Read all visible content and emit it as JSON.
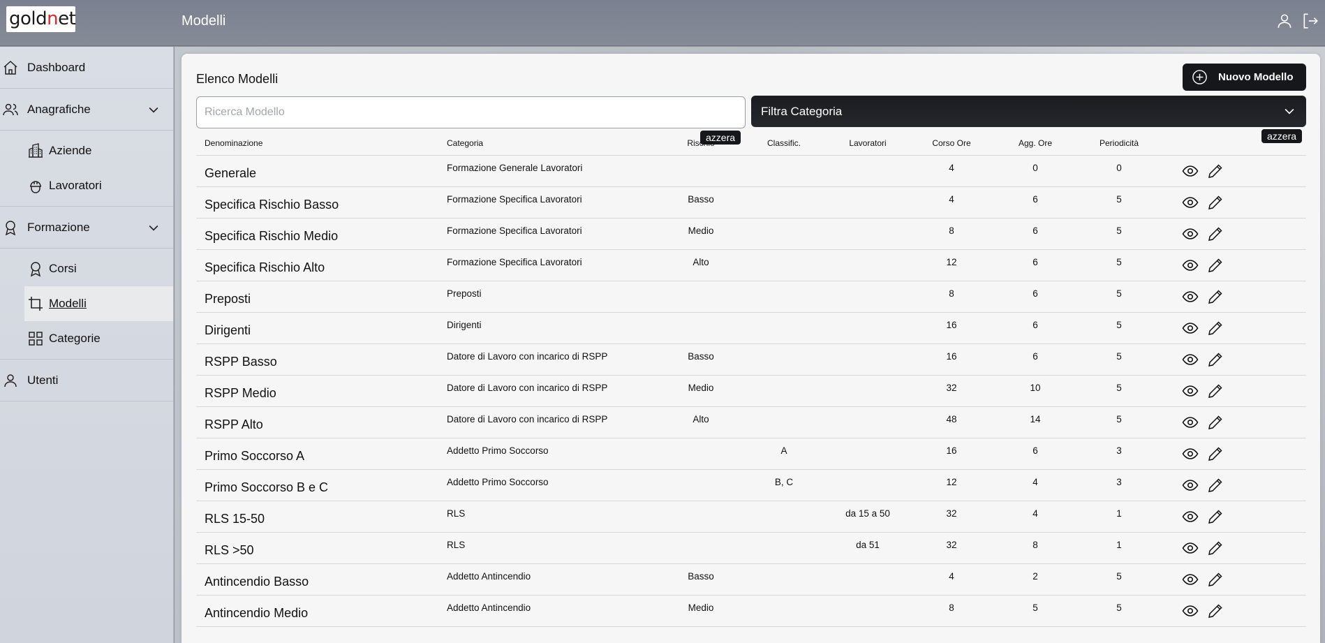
{
  "brand": {
    "logo_prefix": "gold",
    "logo_accent": "n",
    "logo_suffix": "et"
  },
  "header": {
    "title": "Modelli"
  },
  "sidebar": {
    "dashboard": "Dashboard",
    "anagrafiche": "Anagrafiche",
    "aziende": "Aziende",
    "lavoratori": "Lavoratori",
    "formazione": "Formazione",
    "corsi": "Corsi",
    "modelli": "Modelli",
    "categorie": "Categorie",
    "utenti": "Utenti"
  },
  "main": {
    "title": "Elenco Modelli",
    "new_button": "Nuovo Modello",
    "search_placeholder": "Ricerca Modello",
    "filter_label": "Filtra Categoria",
    "reset_label": "azzera"
  },
  "table": {
    "headers": {
      "name": "Denominazione",
      "category": "Categoria",
      "risk": "Rischio",
      "classification": "Classific.",
      "workers": "Lavoratori",
      "course_hours": "Corso Ore",
      "update_hours": "Agg. Ore",
      "periodicity": "Periodicità"
    },
    "rows": [
      {
        "name": "Generale",
        "category": "Formazione Generale Lavoratori",
        "risk": "",
        "classification": "",
        "workers": "",
        "course_hours": "4",
        "update_hours": "0",
        "periodicity": "0"
      },
      {
        "name": "Specifica Rischio Basso",
        "category": "Formazione Specifica Lavoratori",
        "risk": "Basso",
        "classification": "",
        "workers": "",
        "course_hours": "4",
        "update_hours": "6",
        "periodicity": "5"
      },
      {
        "name": "Specifica Rischio Medio",
        "category": "Formazione Specifica Lavoratori",
        "risk": "Medio",
        "classification": "",
        "workers": "",
        "course_hours": "8",
        "update_hours": "6",
        "periodicity": "5"
      },
      {
        "name": "Specifica Rischio Alto",
        "category": "Formazione Specifica Lavoratori",
        "risk": "Alto",
        "classification": "",
        "workers": "",
        "course_hours": "12",
        "update_hours": "6",
        "periodicity": "5"
      },
      {
        "name": "Preposti",
        "category": "Preposti",
        "risk": "",
        "classification": "",
        "workers": "",
        "course_hours": "8",
        "update_hours": "6",
        "periodicity": "5"
      },
      {
        "name": "Dirigenti",
        "category": "Dirigenti",
        "risk": "",
        "classification": "",
        "workers": "",
        "course_hours": "16",
        "update_hours": "6",
        "periodicity": "5"
      },
      {
        "name": "RSPP Basso",
        "category": "Datore di Lavoro con incarico di RSPP",
        "risk": "Basso",
        "classification": "",
        "workers": "",
        "course_hours": "16",
        "update_hours": "6",
        "periodicity": "5"
      },
      {
        "name": "RSPP Medio",
        "category": "Datore di Lavoro con incarico di RSPP",
        "risk": "Medio",
        "classification": "",
        "workers": "",
        "course_hours": "32",
        "update_hours": "10",
        "periodicity": "5"
      },
      {
        "name": "RSPP Alto",
        "category": "Datore di Lavoro con incarico di RSPP",
        "risk": "Alto",
        "classification": "",
        "workers": "",
        "course_hours": "48",
        "update_hours": "14",
        "periodicity": "5"
      },
      {
        "name": "Primo Soccorso A",
        "category": "Addetto Primo Soccorso",
        "risk": "",
        "classification": "A",
        "workers": "",
        "course_hours": "16",
        "update_hours": "6",
        "periodicity": "3"
      },
      {
        "name": "Primo Soccorso B e C",
        "category": "Addetto Primo Soccorso",
        "risk": "",
        "classification": "B, C",
        "workers": "",
        "course_hours": "12",
        "update_hours": "4",
        "periodicity": "3"
      },
      {
        "name": "RLS 15-50",
        "category": "RLS",
        "risk": "",
        "classification": "",
        "workers": "da 15 a 50",
        "course_hours": "32",
        "update_hours": "4",
        "periodicity": "1"
      },
      {
        "name": "RLS >50",
        "category": "RLS",
        "risk": "",
        "classification": "",
        "workers": "da 51",
        "course_hours": "32",
        "update_hours": "8",
        "periodicity": "1"
      },
      {
        "name": "Antincendio Basso",
        "category": "Addetto Antincendio",
        "risk": "Basso",
        "classification": "",
        "workers": "",
        "course_hours": "4",
        "update_hours": "2",
        "periodicity": "5"
      },
      {
        "name": "Antincendio Medio",
        "category": "Addetto Antincendio",
        "risk": "Medio",
        "classification": "",
        "workers": "",
        "course_hours": "8",
        "update_hours": "5",
        "periodicity": "5"
      }
    ]
  }
}
